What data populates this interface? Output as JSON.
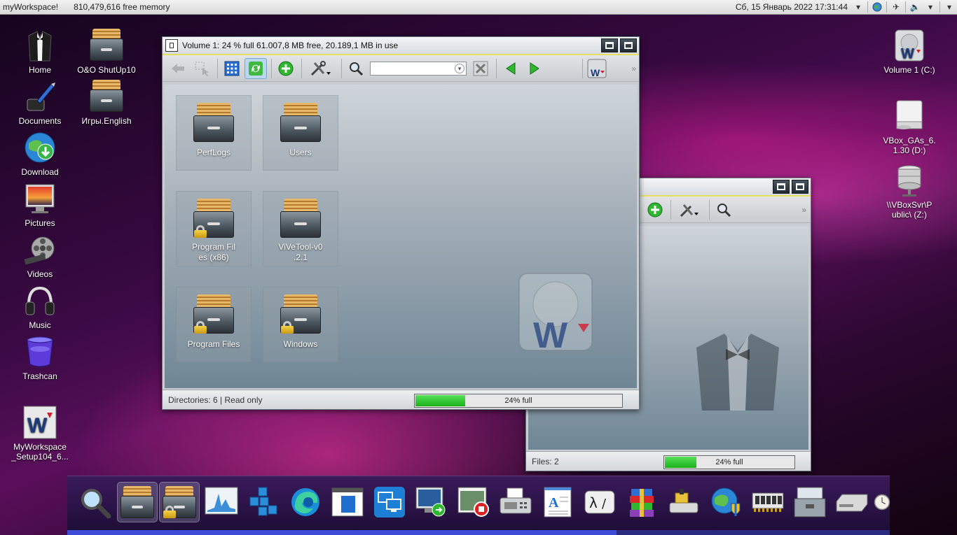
{
  "top_panel": {
    "app_name": "myWorkspace!",
    "memory": "810,479,616 free memory",
    "clock": "Сб, 15 Январь 2022 17:31:44",
    "icons": [
      "dropdown-icon",
      "globe-icon",
      "airplane-icon",
      "volume-icon",
      "dropdown-icon",
      "dropdown-icon"
    ]
  },
  "desktop_left": [
    {
      "label": "Home",
      "icon": "tuxedo-icon"
    },
    {
      "label": "Documents",
      "icon": "ink-pen-icon"
    },
    {
      "label": "Download",
      "icon": "globe-download-icon"
    },
    {
      "label": "Pictures",
      "icon": "monitor-picture-icon"
    },
    {
      "label": "Videos",
      "icon": "film-reel-icon"
    },
    {
      "label": "Music",
      "icon": "headphones-icon"
    },
    {
      "label": "Trashcan",
      "icon": "trashcan-icon"
    },
    {
      "label": "MyWorkspace\n_Setup104_6...",
      "icon": "myworkspace-logo-icon"
    }
  ],
  "desktop_second": [
    {
      "label": "O&O ShutUp10",
      "icon": "file-cabinet-icon"
    },
    {
      "label": "Игры.English",
      "icon": "file-cabinet-icon"
    }
  ],
  "desktop_right": [
    {
      "label": "Volume 1 (C:)",
      "icon": "hard-drive-icon"
    },
    {
      "label": "VBox_GAs_6.\n1.30 (D:)",
      "icon": "cd-drive-icon"
    },
    {
      "label": "\\\\VBoxSvr\\P\nublic\\ (Z:)",
      "icon": "network-drive-icon"
    }
  ],
  "main_window": {
    "title": "Volume 1:  24 % full 61.007,8 MB free, 20.189,1 MB in use",
    "search_value": "",
    "folders": [
      {
        "label": "PerfLogs",
        "locked": false
      },
      {
        "label": "Users",
        "locked": false
      },
      {
        "label": "Program Fil\nes (x86)",
        "locked": true
      },
      {
        "label": "ViVeTool-v0\n.2.1",
        "locked": false
      },
      {
        "label": "Program Files",
        "locked": true
      },
      {
        "label": "Windows",
        "locked": true
      }
    ],
    "status_text": "Directories: 6 | Read only",
    "progress_label": "24% full",
    "progress_value": 0.24
  },
  "back_window": {
    "status_text": "Files: 2",
    "progress_label": "24% full",
    "progress_value": 0.24
  },
  "dock": {
    "items": [
      "magnifier-icon",
      "file-cabinet-icon",
      "file-cabinet-locked-icon",
      "activity-monitor-icon",
      "package-cubes-icon",
      "edge-browser-icon",
      "window-panel-icon",
      "remote-desktop-icon",
      "remote-monitor-icon",
      "screen-recorder-icon",
      "fax-printer-icon",
      "text-document-icon",
      "lambda-calculator-icon",
      "archive-stack-icon",
      "drive-tool-icon",
      "network-shield-icon",
      "memory-chip-icon",
      "toolbox-icon",
      "external-drive-icon",
      "clock-icon"
    ]
  }
}
